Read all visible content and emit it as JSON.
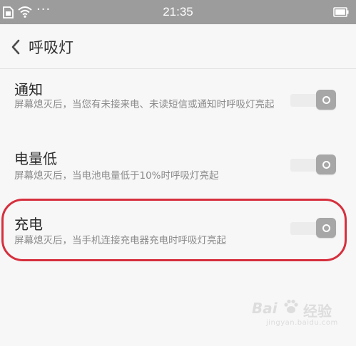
{
  "status_bar": {
    "time": "21:35",
    "left_icons": [
      "sim-icon",
      "wifi-icon",
      "more-dots-icon"
    ],
    "right_icons": [
      "battery-icon"
    ],
    "dots": "···"
  },
  "header": {
    "title": "呼吸灯",
    "back_icon": "chevron-left-icon"
  },
  "settings": [
    {
      "title": "通知",
      "description": "屏幕熄灭后，当您有未接来电、未读短信或通知时呼吸灯亮起",
      "enabled": false
    },
    {
      "title": "电量低",
      "description": "屏幕熄灭后，当电池电量低于10%时呼吸灯亮起",
      "enabled": false
    },
    {
      "title": "充电",
      "description": "屏幕熄灭后，当手机连接充电器充电时呼吸灯亮起",
      "enabled": false,
      "highlighted": true
    }
  ],
  "watermark": {
    "brand_left": "Bai",
    "brand_right": "经验",
    "url": "jingyan.baidu.com"
  },
  "colors": {
    "status_bar_bg": "#9c9c9c",
    "page_bg": "#f7f7f7",
    "highlight_ring": "#d62f3d",
    "toggle_knob": "#a7a7a7"
  }
}
